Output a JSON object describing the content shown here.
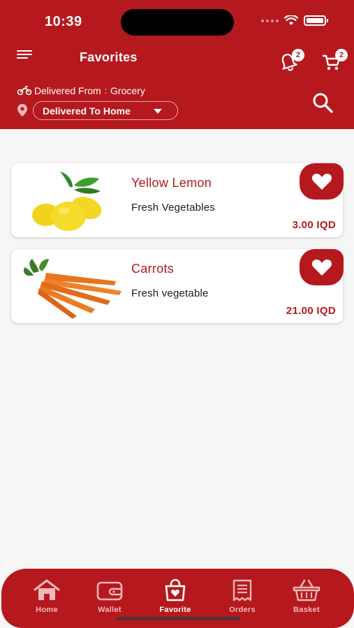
{
  "status_bar": {
    "time": "10:39"
  },
  "header": {
    "title": "Favorites",
    "notifications_count": "2",
    "cart_count": "2",
    "delivered_from_label": "Delivered From",
    "delivered_from_separator": ":",
    "delivered_from_value": "Grocery",
    "delivery_location": "Delivered To Home"
  },
  "favorites": [
    {
      "name": "Yellow Lemon",
      "category": "Fresh Vegetables",
      "price": "3.00 IQD",
      "image": "lemon-image"
    },
    {
      "name": "Carrots",
      "category": "Fresh vegetable",
      "price": "21.00 IQD",
      "image": "carrot-image"
    }
  ],
  "bottom_nav": [
    {
      "label": "Home",
      "icon": "home-icon",
      "active": false
    },
    {
      "label": "Wallet",
      "icon": "wallet-icon",
      "active": false
    },
    {
      "label": "Favorite",
      "icon": "favorite-bag-icon",
      "active": true
    },
    {
      "label": "Orders",
      "icon": "orders-icon",
      "active": false
    },
    {
      "label": "Basket",
      "icon": "basket-icon",
      "active": false
    }
  ],
  "colors": {
    "brand": "#b5191d",
    "background": "#f6f6f6",
    "card": "#ffffff"
  }
}
